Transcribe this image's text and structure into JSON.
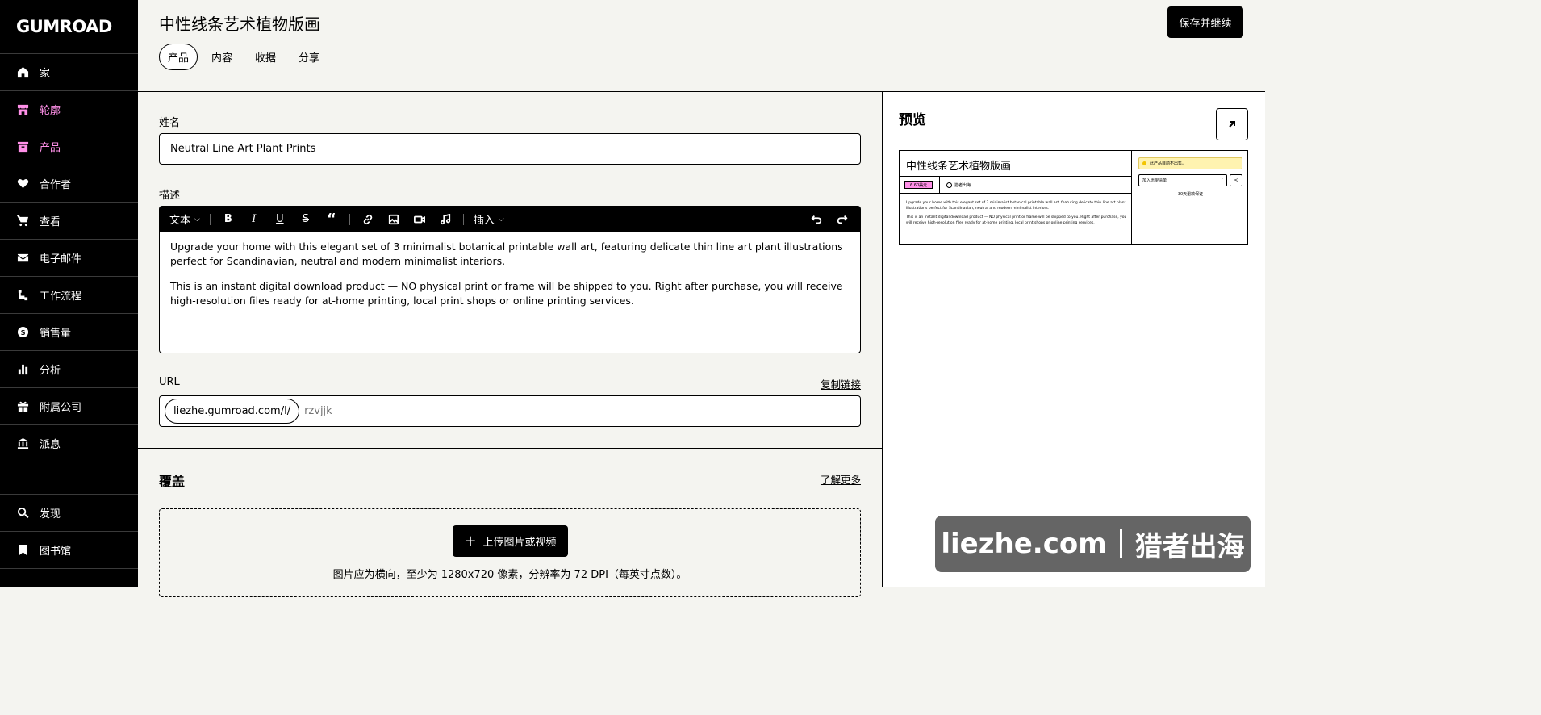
{
  "sidebar": {
    "logo": "GUMROAD",
    "items": [
      {
        "label": "家",
        "icon": "home-icon"
      },
      {
        "label": "轮廓",
        "icon": "storefront-icon"
      },
      {
        "label": "产品",
        "icon": "archive-icon"
      },
      {
        "label": "合作者",
        "icon": "handshake-icon"
      },
      {
        "label": "查看",
        "icon": "cart-icon"
      },
      {
        "label": "电子邮件",
        "icon": "envelope-icon"
      },
      {
        "label": "工作流程",
        "icon": "workflow-icon"
      },
      {
        "label": "销售量",
        "icon": "dollar-icon"
      },
      {
        "label": "分析",
        "icon": "bar-chart-icon"
      },
      {
        "label": "附属公司",
        "icon": "gift-icon"
      },
      {
        "label": "派息",
        "icon": "bank-icon"
      }
    ],
    "bottom_items": [
      {
        "label": "发现",
        "icon": "search-icon"
      },
      {
        "label": "图书馆",
        "icon": "bookmark-icon"
      }
    ],
    "accent_color": "#ff90e8"
  },
  "header": {
    "title": "中性线条艺术植物版画",
    "save_label": "保存并继续",
    "tabs": [
      {
        "label": "产品"
      },
      {
        "label": "内容"
      },
      {
        "label": "收据"
      },
      {
        "label": "分享"
      }
    ]
  },
  "form": {
    "name_label": "姓名",
    "name_value": "Neutral Line Art Plant Prints",
    "description_label": "描述",
    "toolbar": {
      "text_style": "文本",
      "insert": "插入"
    },
    "description_paragraphs": [
      "Upgrade your home with this elegant set of 3 minimalist botanical printable wall art, featuring delicate thin line art plant illustrations perfect for Scandinavian, neutral and modern minimalist interiors.",
      "This is an instant digital download product — NO physical print or frame will be shipped to you. Right after purchase, you will receive high-resolution files ready for at-home printing, local print shops or online printing services."
    ],
    "url_label": "URL",
    "copy_link": "复制链接",
    "url_prefix": "liezhe.gumroad.com/l/",
    "url_slug_placeholder": "rzvjjk"
  },
  "cover": {
    "title": "覆盖",
    "learn_more": "了解更多",
    "upload_label": "上传图片或视频",
    "hint": "图片应为横向，至少为 1280x720 像素，分辨率为 72 DPI（每英寸点数）。"
  },
  "preview": {
    "title": "预览",
    "mini": {
      "title": "中性线条艺术植物版画",
      "price": "6.60美元",
      "seller": "猎者出海",
      "desc": [
        "Upgrade your home with this elegant set of 3 minimalist botanical printable wall art, featuring delicate thin line art plant illustrations perfect for Scandinavian, neutral and modern minimalist interiors.",
        "This is an instant digital download product — NO physical print or frame will be shipped to you. Right after purchase, you will receive high-resolution files ready for at-home printing, local print shops or online printing services."
      ],
      "warning": "此产品目前不出售。",
      "wishlist": "加入愿望清单",
      "guarantee": "30天退款保证"
    }
  },
  "watermark": {
    "left": "liezhe.com",
    "right": "猎者出海"
  }
}
